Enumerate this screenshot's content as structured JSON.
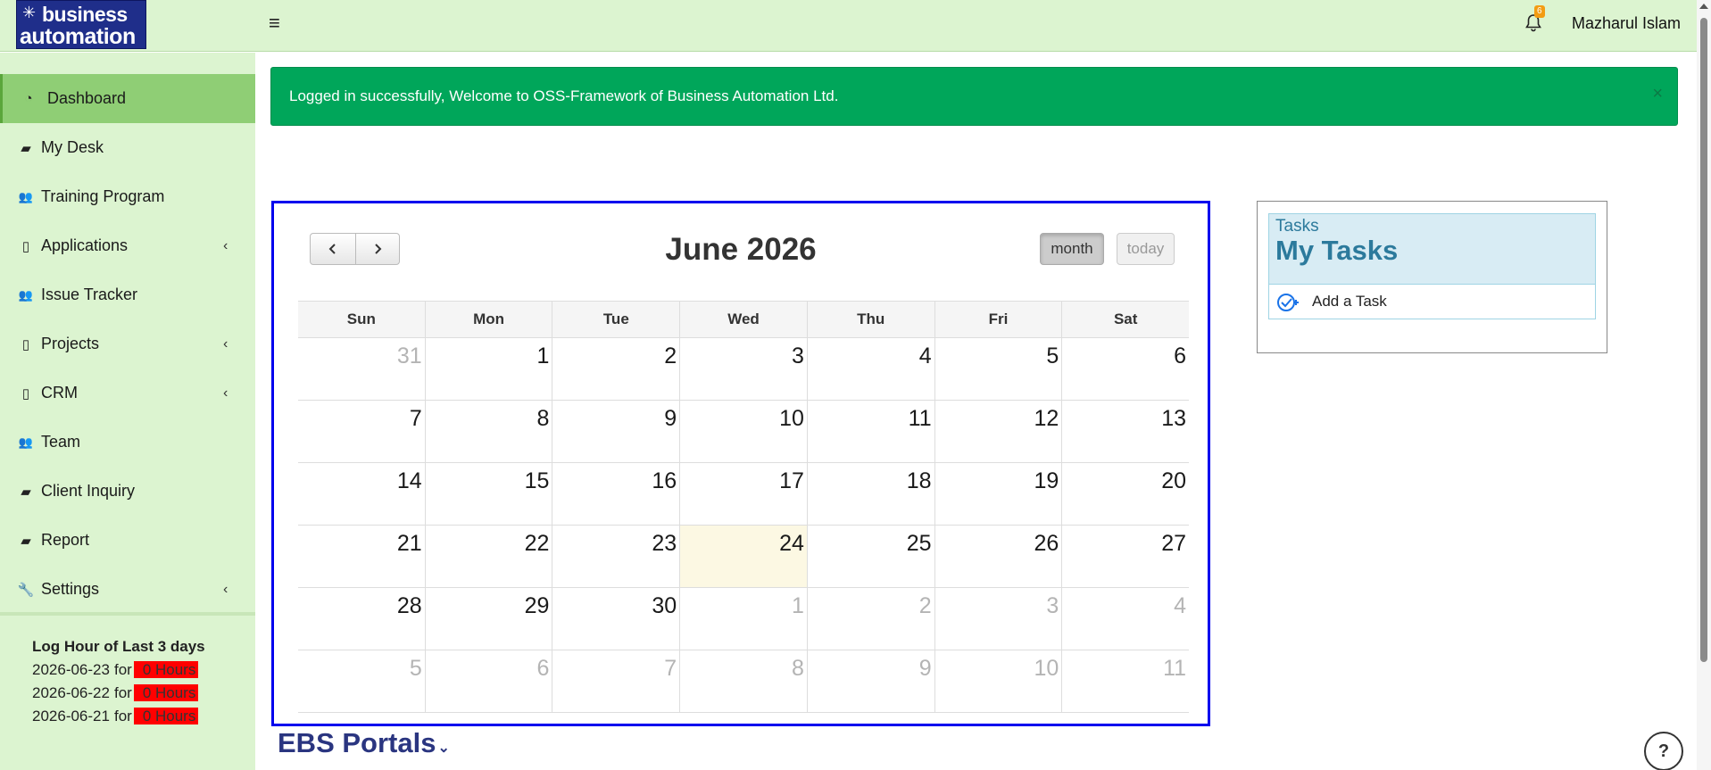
{
  "header": {
    "logo_line1": "business",
    "logo_line2": "automation",
    "notification_count": "6",
    "user_name": "Mazharul Islam"
  },
  "sidebar": {
    "items": [
      {
        "label": "Dashboard",
        "icon": "dashboard-icon",
        "active": true
      },
      {
        "label": "My Desk",
        "icon": "book-icon"
      },
      {
        "label": "Training Program",
        "icon": "users-icon"
      },
      {
        "label": "Applications",
        "icon": "file-icon",
        "has_submenu": true
      },
      {
        "label": "Issue Tracker",
        "icon": "users-icon"
      },
      {
        "label": "Projects",
        "icon": "file-icon",
        "has_submenu": true
      },
      {
        "label": "CRM",
        "icon": "file-icon",
        "has_submenu": true
      },
      {
        "label": "Team",
        "icon": "users-icon"
      },
      {
        "label": "Client Inquiry",
        "icon": "book-icon"
      },
      {
        "label": "Report",
        "icon": "book-icon"
      },
      {
        "label": "Settings",
        "icon": "wrench-icon",
        "has_submenu": true
      }
    ],
    "log_hours": {
      "title": "Log Hour of Last 3 days",
      "entries": [
        {
          "date": "2026-06-23",
          "connector": "for",
          "value": "0 Hours"
        },
        {
          "date": "2026-06-22",
          "connector": "for",
          "value": "0 Hours"
        },
        {
          "date": "2026-06-21",
          "connector": "for",
          "value": "0 Hours"
        }
      ]
    }
  },
  "alert": {
    "message": "Logged in successfully, Welcome to OSS-Framework of Business Automation Ltd.",
    "close": "×"
  },
  "calendar": {
    "title": "June 2026",
    "view_month": "month",
    "view_today": "today",
    "weekdays": [
      "Sun",
      "Mon",
      "Tue",
      "Wed",
      "Thu",
      "Fri",
      "Sat"
    ],
    "weeks": [
      [
        {
          "d": "31",
          "o": true
        },
        {
          "d": "1"
        },
        {
          "d": "2"
        },
        {
          "d": "3"
        },
        {
          "d": "4"
        },
        {
          "d": "5"
        },
        {
          "d": "6"
        }
      ],
      [
        {
          "d": "7"
        },
        {
          "d": "8"
        },
        {
          "d": "9"
        },
        {
          "d": "10"
        },
        {
          "d": "11"
        },
        {
          "d": "12"
        },
        {
          "d": "13"
        }
      ],
      [
        {
          "d": "14"
        },
        {
          "d": "15"
        },
        {
          "d": "16"
        },
        {
          "d": "17"
        },
        {
          "d": "18"
        },
        {
          "d": "19"
        },
        {
          "d": "20"
        }
      ],
      [
        {
          "d": "21"
        },
        {
          "d": "22"
        },
        {
          "d": "23"
        },
        {
          "d": "24",
          "t": true
        },
        {
          "d": "25"
        },
        {
          "d": "26"
        },
        {
          "d": "27"
        }
      ],
      [
        {
          "d": "28"
        },
        {
          "d": "29"
        },
        {
          "d": "30"
        },
        {
          "d": "1",
          "o": true
        },
        {
          "d": "2",
          "o": true
        },
        {
          "d": "3",
          "o": true
        },
        {
          "d": "4",
          "o": true
        }
      ],
      [
        {
          "d": "5",
          "o": true
        },
        {
          "d": "6",
          "o": true
        },
        {
          "d": "7",
          "o": true
        },
        {
          "d": "8",
          "o": true
        },
        {
          "d": "9",
          "o": true
        },
        {
          "d": "10",
          "o": true
        },
        {
          "d": "11",
          "o": true
        }
      ]
    ]
  },
  "ebs_portals": {
    "label": "EBS Portals"
  },
  "tasks": {
    "small_title": "Tasks",
    "title": "My Tasks",
    "add_label": "Add a Task"
  },
  "help": {
    "label": "?"
  },
  "colors": {
    "header_bg": "#dcf4d0",
    "sidebar_active": "#8fce75",
    "alert_bg": "#00a65a",
    "calendar_border": "#0000ee",
    "today_bg": "#fcf8e3",
    "log_badge": "#ff0000",
    "task_header_bg": "#d8ecf4"
  }
}
